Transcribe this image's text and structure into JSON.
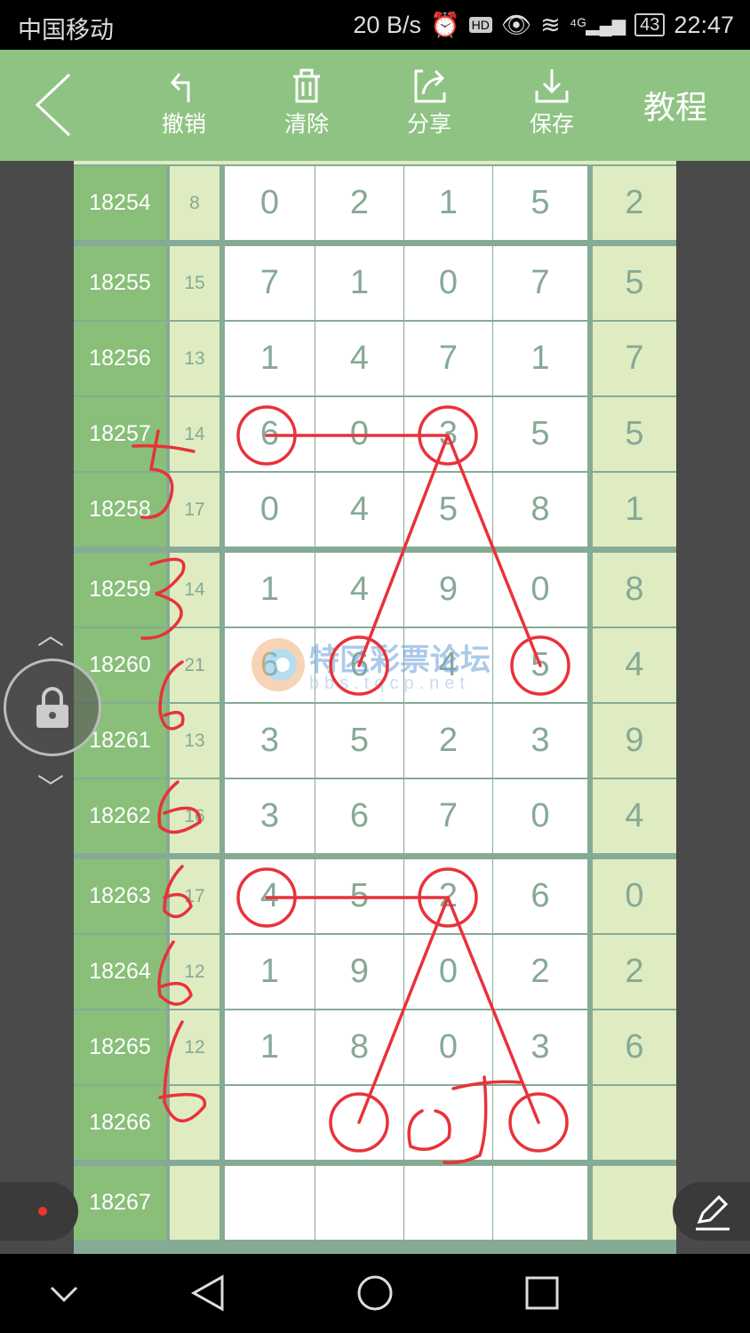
{
  "status": {
    "carrier": "中国移动",
    "speed": "20 B/s",
    "battery": "43",
    "time": "22:47",
    "icons": [
      "alarm-icon",
      "hd-icon",
      "eye-icon",
      "wifi-icon",
      "4g-signal-icon"
    ]
  },
  "toolbar": {
    "undo": "撤销",
    "clear": "清除",
    "share": "分享",
    "save": "保存",
    "tutorial": "教程"
  },
  "watermark": {
    "name": "特区彩票论坛",
    "url": "bbs.tqcp.net"
  },
  "colors": {
    "toolbar": "#8fc383",
    "issue": "#89bf79",
    "sum": "#dfecc2",
    "digit_text": "#86a995",
    "annotation": "#e8323a"
  },
  "rows": [
    {
      "issue": "18254",
      "sum": "8",
      "digits": [
        "0",
        "2",
        "1",
        "5"
      ],
      "last": "2"
    },
    {
      "issue": "18255",
      "sum": "15",
      "digits": [
        "7",
        "1",
        "0",
        "7"
      ],
      "last": "5"
    },
    {
      "issue": "18256",
      "sum": "13",
      "digits": [
        "1",
        "4",
        "7",
        "1"
      ],
      "last": "7"
    },
    {
      "issue": "18257",
      "sum": "14",
      "digits": [
        "6",
        "0",
        "3",
        "5"
      ],
      "last": "5"
    },
    {
      "issue": "18258",
      "sum": "17",
      "digits": [
        "0",
        "4",
        "5",
        "8"
      ],
      "last": "1"
    },
    {
      "issue": "18259",
      "sum": "14",
      "digits": [
        "1",
        "4",
        "9",
        "0"
      ],
      "last": "8"
    },
    {
      "issue": "18260",
      "sum": "21",
      "digits": [
        "6",
        "6",
        "4",
        "5"
      ],
      "last": "4"
    },
    {
      "issue": "18261",
      "sum": "13",
      "digits": [
        "3",
        "5",
        "2",
        "3"
      ],
      "last": "9"
    },
    {
      "issue": "18262",
      "sum": "16",
      "digits": [
        "3",
        "6",
        "7",
        "0"
      ],
      "last": "4"
    },
    {
      "issue": "18263",
      "sum": "17",
      "digits": [
        "4",
        "5",
        "2",
        "6"
      ],
      "last": "0"
    },
    {
      "issue": "18264",
      "sum": "12",
      "digits": [
        "1",
        "9",
        "0",
        "2"
      ],
      "last": "2"
    },
    {
      "issue": "18265",
      "sum": "12",
      "digits": [
        "1",
        "8",
        "0",
        "3"
      ],
      "last": "6"
    },
    {
      "issue": "18266",
      "sum": "",
      "digits": [
        "",
        "",
        "",
        ""
      ],
      "last": ""
    },
    {
      "issue": "18267",
      "sum": "",
      "digits": [
        "",
        "",
        "",
        ""
      ],
      "last": ""
    }
  ]
}
